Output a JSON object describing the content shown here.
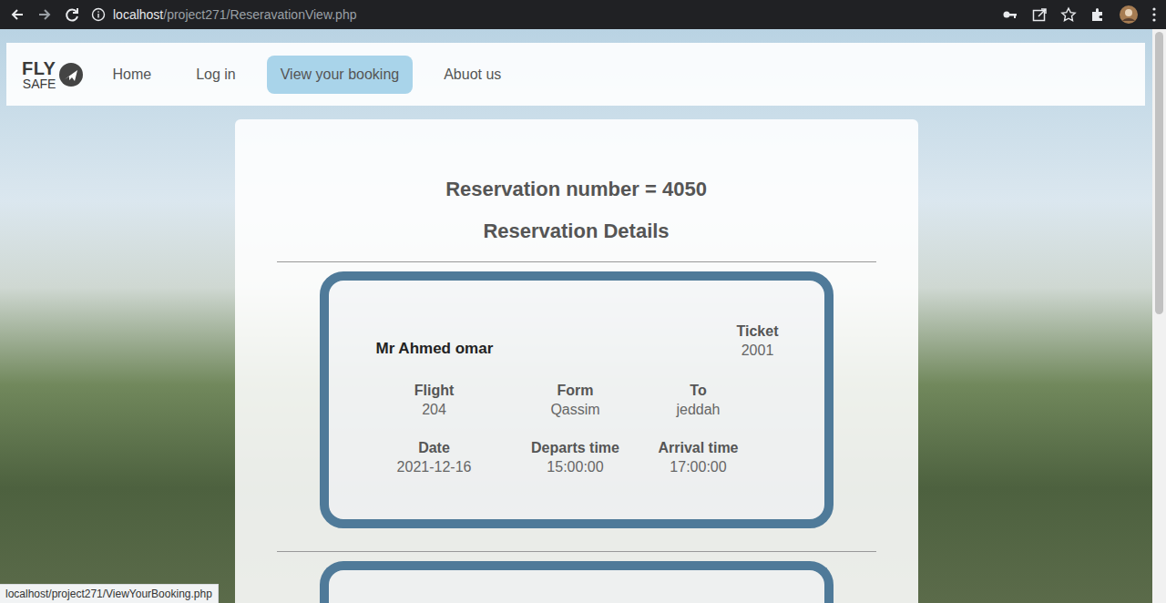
{
  "browser": {
    "url_host": "localhost",
    "url_path": "/project271/ReseravationView.php",
    "status_url": "localhost/project271/ViewYourBooking.php"
  },
  "logo": {
    "line1": "FLY",
    "line2": "SAFE"
  },
  "nav": [
    {
      "label": "Home",
      "selected": false
    },
    {
      "label": "Log in",
      "selected": false
    },
    {
      "label": "View your booking",
      "selected": true
    },
    {
      "label": "Abuot us",
      "selected": false
    }
  ],
  "reservation": {
    "heading": "Reservation number = 4050",
    "subheading": "Reservation Details"
  },
  "tickets": [
    {
      "passenger": "Mr Ahmed omar",
      "ticket_label": "Ticket",
      "ticket_number": "2001",
      "fields": [
        {
          "label": "Flight",
          "value": "204"
        },
        {
          "label": "Form",
          "value": "Qassim"
        },
        {
          "label": "To",
          "value": "jeddah"
        },
        {
          "label": "Date",
          "value": "2021-12-16"
        },
        {
          "label": "Departs time",
          "value": "15:00:00"
        },
        {
          "label": "Arrival time",
          "value": "17:00:00"
        }
      ]
    }
  ]
}
